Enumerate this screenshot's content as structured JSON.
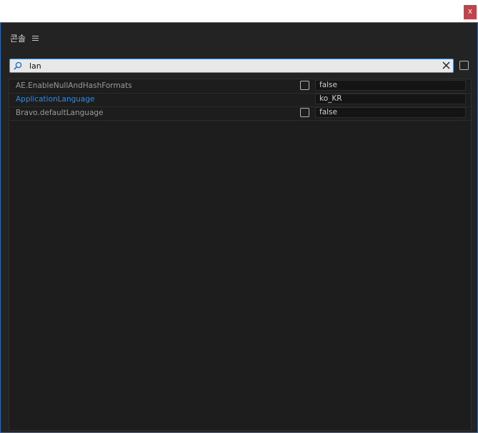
{
  "window": {
    "close_label": "x"
  },
  "panel": {
    "title": "콘솔"
  },
  "search": {
    "value": "lan"
  },
  "rows": [
    {
      "key": "AE.EnableNullAndHashFormats",
      "has_checkbox": true,
      "value": "false"
    },
    {
      "key": "ApplicationLanguage",
      "has_checkbox": false,
      "value": "ko_KR"
    },
    {
      "key": "Bravo.defaultLanguage",
      "has_checkbox": true,
      "value": "false"
    }
  ],
  "colors": {
    "accent": "#2d6fc0",
    "close": "#c4424a",
    "active_key": "#2e8ce0"
  }
}
